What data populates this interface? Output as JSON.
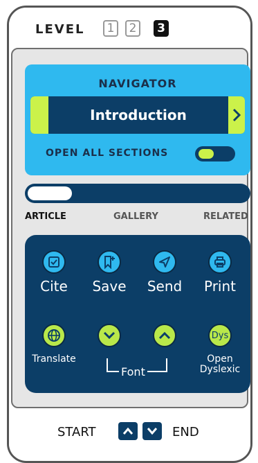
{
  "level": {
    "label": "LEVEL",
    "options": [
      "1",
      "2",
      "3"
    ],
    "selected": "3"
  },
  "navigator": {
    "title": "NAVIGATOR",
    "current_section": "Introduction",
    "open_all_label": "OPEN ALL SECTIONS",
    "open_all_enabled": true
  },
  "progress": {
    "fraction": 0.2
  },
  "tabs": [
    {
      "label": "ARTICLE",
      "active": true
    },
    {
      "label": "GALLERY",
      "active": false
    },
    {
      "label": "RELATED",
      "active": false
    }
  ],
  "tools": {
    "cite": "Cite",
    "save": "Save",
    "send": "Send",
    "print": "Print",
    "translate": "Translate",
    "font": "Font",
    "dys_icon": "Dys",
    "open_dyslexic_1": "Open",
    "open_dyslexic_2": "Dyslexic"
  },
  "footer": {
    "start": "START",
    "end": "END"
  },
  "colors": {
    "navy": "#0c3e67",
    "sky": "#2fb9ef",
    "lime": "#cbf24a"
  }
}
